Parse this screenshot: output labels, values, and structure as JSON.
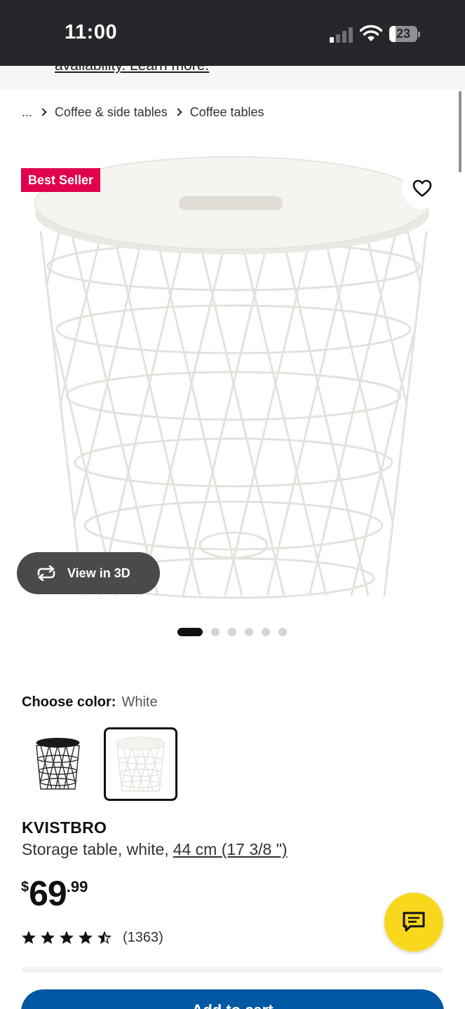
{
  "status_bar": {
    "time": "11:00",
    "battery": "23",
    "signal_bars_active": 1,
    "signal_bars_total": 4
  },
  "banner": {
    "text": "availability. Learn more."
  },
  "breadcrumb": {
    "items": [
      "...",
      "Coffee & side tables",
      "Coffee tables"
    ]
  },
  "gallery": {
    "badge": "Best Seller",
    "view_3d_label": "View in 3D",
    "image_count": 6,
    "active_index": 0
  },
  "color_selector": {
    "label": "Choose color:",
    "selected": "White",
    "options": [
      "Black",
      "White"
    ]
  },
  "product": {
    "name": "KVISTBRO",
    "description": "Storage table, white,",
    "size": "44 cm (17 3/8 \")",
    "price_currency": "$",
    "price_integer": "69",
    "price_decimal": ".99",
    "rating": 4.5,
    "review_count": "(1363)"
  },
  "actions": {
    "add_to_cart_label": "Add to cart"
  },
  "colors": {
    "status_bar_bg": "#25272a",
    "badge_bg": "#e0004d",
    "chat_bg": "#f9d71c",
    "primary_button_bg": "#0058a3"
  },
  "icons": {
    "favorite": "heart-icon",
    "view_3d": "rotate-icon",
    "chat": "chat-bubble-icon",
    "rating": "star-icon"
  }
}
